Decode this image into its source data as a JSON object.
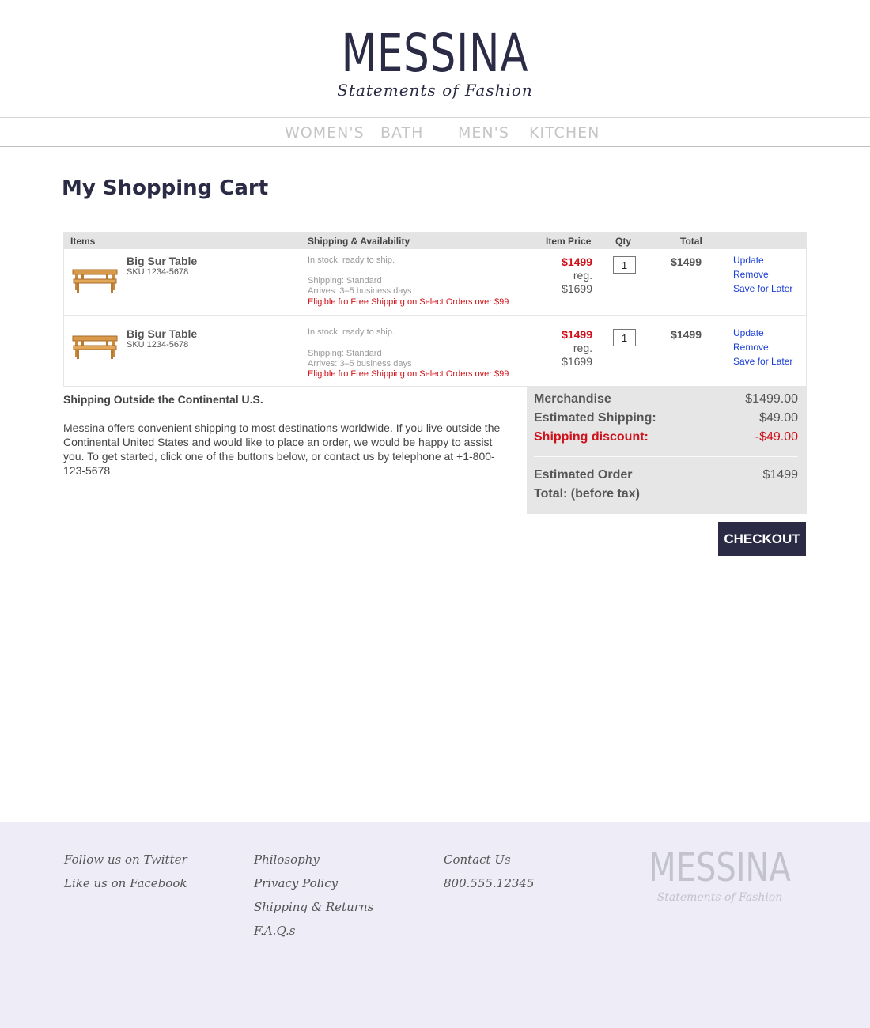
{
  "brand": {
    "name": "MESSINA",
    "tagline": "Statements of Fashion"
  },
  "nav": {
    "items": [
      {
        "label": "WOMEN'S"
      },
      {
        "label": "BATH"
      },
      {
        "label": "MEN'S"
      },
      {
        "label": "KITCHEN"
      }
    ]
  },
  "page": {
    "title": "My Shopping Cart"
  },
  "cart": {
    "columns": {
      "items": "Items",
      "shipping": "Shipping & Availability",
      "price": "Item Price",
      "qty": "Qty",
      "total": "Total"
    },
    "rows": [
      {
        "name": "Big Sur Table",
        "sku": "SKU 1234-5678",
        "stock": "In stock, ready to ship.",
        "shipping": "Shipping: Standard",
        "arrives": "Arrives: 3–5 business days",
        "promo": "Eligible fro Free Shipping on Select Orders over $99",
        "sale_price": "$1499",
        "reg_label": "reg.",
        "reg_price": "$1699",
        "qty": "1",
        "total": "$1499",
        "actions": {
          "update": "Update",
          "remove": "Remove",
          "save": "Save for Later"
        }
      },
      {
        "name": "Big Sur Table",
        "sku": "SKU 1234-5678",
        "stock": "In stock, ready to ship.",
        "shipping": "Shipping: Standard",
        "arrives": "Arrives: 3–5 business days",
        "promo": "Eligible fro Free Shipping on Select Orders over $99",
        "sale_price": "$1499",
        "reg_label": "reg.",
        "reg_price": "$1699",
        "qty": "1",
        "total": "$1499",
        "actions": {
          "update": "Update",
          "remove": "Remove",
          "save": "Save for Later"
        }
      }
    ]
  },
  "shipping_info": {
    "title": "Shipping Outside the Continental U.S.",
    "body": "Messina offers convenient shipping to most destinations worldwide. If you live outside the Continental United States and would like to place an order, we would be happy to assist you. To get started, click one of the buttons below, or contact us by telephone at +1-800-123-5678"
  },
  "summary": {
    "merchandise_label": "Merchandise",
    "merchandise_value": "$1499.00",
    "shipping_label": "Estimated Shipping:",
    "shipping_value": "$49.00",
    "discount_label": "Shipping discount:",
    "discount_value": "-$49.00",
    "order_label_1": "Estimated Order",
    "order_label_2": "Total: (before tax)",
    "order_value": "$1499"
  },
  "checkout_label": "CHECKOUT",
  "footer": {
    "social": [
      "Follow us on Twitter",
      "Like us on Facebook"
    ],
    "info": [
      "Philosophy",
      "Privacy Policy",
      "Shipping & Returns",
      "F.A.Q.s"
    ],
    "contact": [
      "Contact Us",
      "800.555.12345"
    ]
  },
  "colors": {
    "brand_navy": "#2b2b46",
    "sale_red": "#d0111a",
    "link_blue": "#1a3ed6",
    "footer_bg": "#edecf7",
    "summary_bg": "#e6e6e6"
  }
}
